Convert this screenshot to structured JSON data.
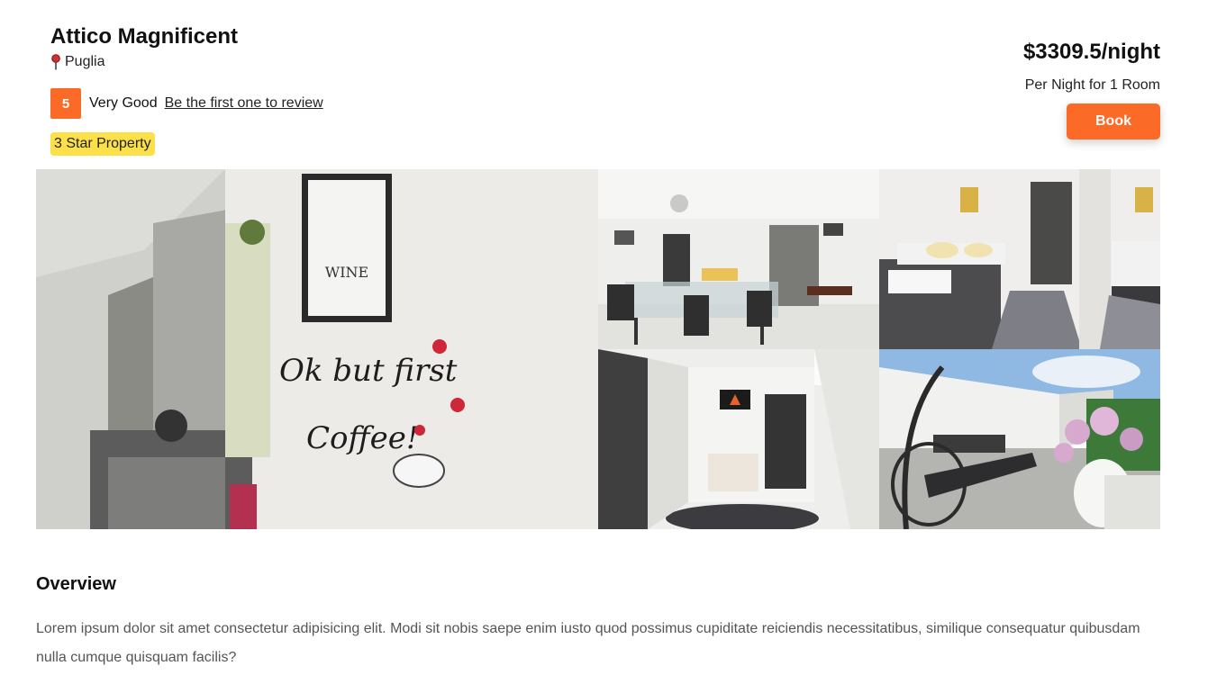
{
  "property": {
    "name": "Attico Magnificent",
    "location": "Puglia",
    "rating_score": "5",
    "rating_label": "Very Good",
    "review_link": "Be the first one to review",
    "star_badge": "3 Star Property"
  },
  "pricing": {
    "price": "$3309.5/night",
    "per_night": "Per Night for 1 Room",
    "book_label": "Book"
  },
  "gallery": {
    "photos": [
      {
        "subject": "kitchen wall with 'Ok but first coffee!' decal"
      },
      {
        "subject": "living and dining room"
      },
      {
        "subject": "bedroom with grey rug"
      },
      {
        "subject": "hallway with fireplace picture"
      },
      {
        "subject": "terrace with hanging chair and flowers"
      }
    ]
  },
  "overview": {
    "heading": "Overview",
    "text": "Lorem ipsum dolor sit amet consectetur adipisicing elit. Modi sit nobis saepe enim iusto quod possimus cupiditate reiciendis necessitatibus, similique consequatur quibusdam nulla cumque quisquam facilis?"
  },
  "colors": {
    "accent": "#fb6a26",
    "badge": "#fbe04a"
  },
  "icons": {
    "location": "map-pin-icon"
  }
}
